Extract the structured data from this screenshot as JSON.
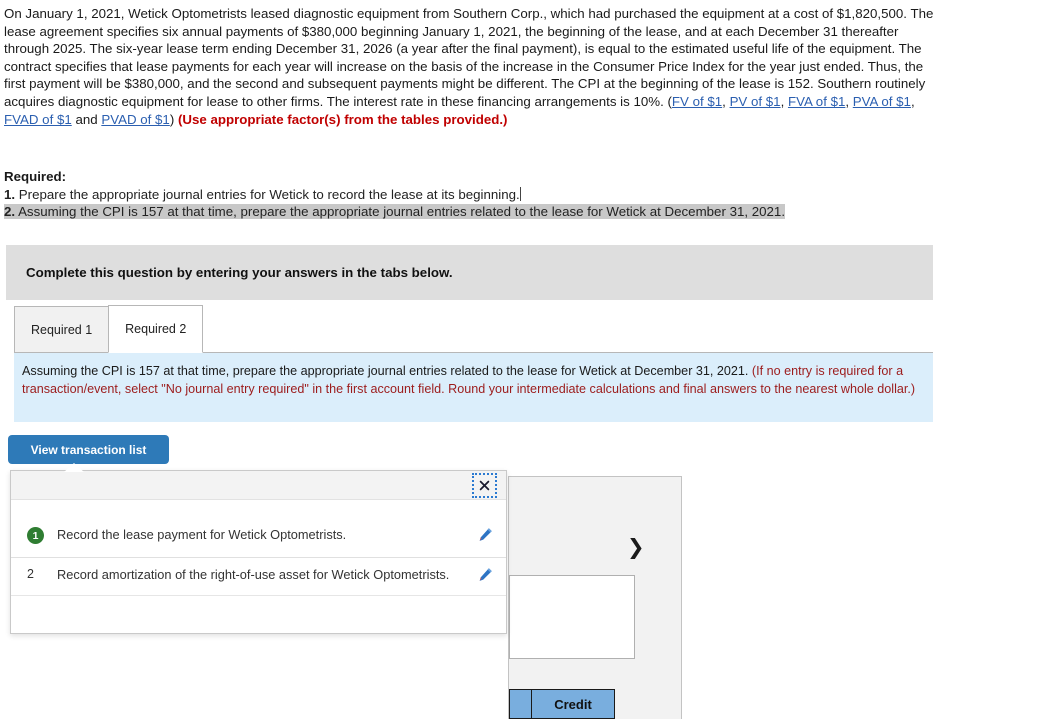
{
  "problem": {
    "paragraph_parts": [
      {
        "t": "text",
        "v": "On January 1, 2021, Wetick Optometrists leased diagnostic equipment from Southern Corp., which had purchased the equipment at a cost of $1,820,500. The lease agreement specifies six annual payments of $380,000 beginning January 1, 2021, the beginning of the lease, and at each December 31 thereafter through 2025. The six-year lease term ending December 31, 2026 (a year after the final payment), is equal to the estimated useful life of the equipment. The contract specifies that lease payments for each year will increase on the basis of the increase in the Consumer Price Index for the year just ended. Thus, the first payment will be $380,000, and the second and subsequent payments might be different. The CPI at the beginning of the lease is 152. Southern routinely acquires diagnostic equipment for lease to other firms. The interest rate in these financing arrangements is 10%. ("
      },
      {
        "t": "link",
        "v": "FV of $1"
      },
      {
        "t": "text",
        "v": ", "
      },
      {
        "t": "link",
        "v": "PV of $1"
      },
      {
        "t": "text",
        "v": ", "
      },
      {
        "t": "link",
        "v": "FVA of $1"
      },
      {
        "t": "text",
        "v": ", "
      },
      {
        "t": "link",
        "v": "PVA of $1"
      },
      {
        "t": "text",
        "v": ", "
      },
      {
        "t": "link",
        "v": "FVAD of $1"
      },
      {
        "t": "text",
        "v": " and "
      },
      {
        "t": "link",
        "v": "PVAD of $1"
      },
      {
        "t": "text",
        "v": ") "
      },
      {
        "t": "redbold",
        "v": "(Use appropriate factor(s) from the tables provided.)"
      }
    ]
  },
  "required": {
    "heading": "Required:",
    "items": [
      {
        "num": "1.",
        "text": "Prepare the appropriate journal entries for Wetick to record the lease at its beginning.",
        "selected": false
      },
      {
        "num": "2.",
        "text": "Assuming the CPI is 157 at that time, prepare the appropriate journal entries related to the lease for Wetick at December 31, 2021.",
        "selected": true
      }
    ]
  },
  "banner": {
    "text": "Complete this question by entering your answers in the tabs below."
  },
  "tabs": [
    {
      "label": "Required 1",
      "active": false
    },
    {
      "label": "Required 2",
      "active": true
    }
  ],
  "instruction_box": {
    "lead": "Assuming the CPI is 157 at that time, prepare the appropriate journal entries related to the lease for Wetick at December 31, 2021.",
    "rest": " (If no entry is required for a transaction/event, select \"No journal entry required\" in the first account field. Round your intermediate calculations and final answers to the nearest whole dollar.)"
  },
  "view_transaction_button": {
    "label": "View transaction list"
  },
  "transaction_popup": {
    "close_icon": "close-x-icon",
    "rows": [
      {
        "num": "1",
        "badge": true,
        "text": "Record the lease payment for Wetick Optometrists.",
        "edit_icon": "pencil-icon"
      },
      {
        "num": "2",
        "badge": false,
        "text": "Record amortization of the right-of-use asset for Wetick Optometrists.",
        "edit_icon": "pencil-icon"
      }
    ]
  },
  "journal_panel": {
    "chevron_icon": "chevron-right-icon",
    "table_headers": [
      "",
      "Credit"
    ]
  },
  "colors": {
    "link": "#2b5fb0",
    "red_bold": "#c00000",
    "instruction_red": "#9c1c1c",
    "instruction_bg": "#dbeefb",
    "banner_bg": "#dedede",
    "button_blue": "#2e7ab8",
    "badge_green": "#2f7d32",
    "pencil_blue": "#2e74c4",
    "table_header_blue": "#79aede",
    "selection_grey": "#c8c8c8"
  }
}
